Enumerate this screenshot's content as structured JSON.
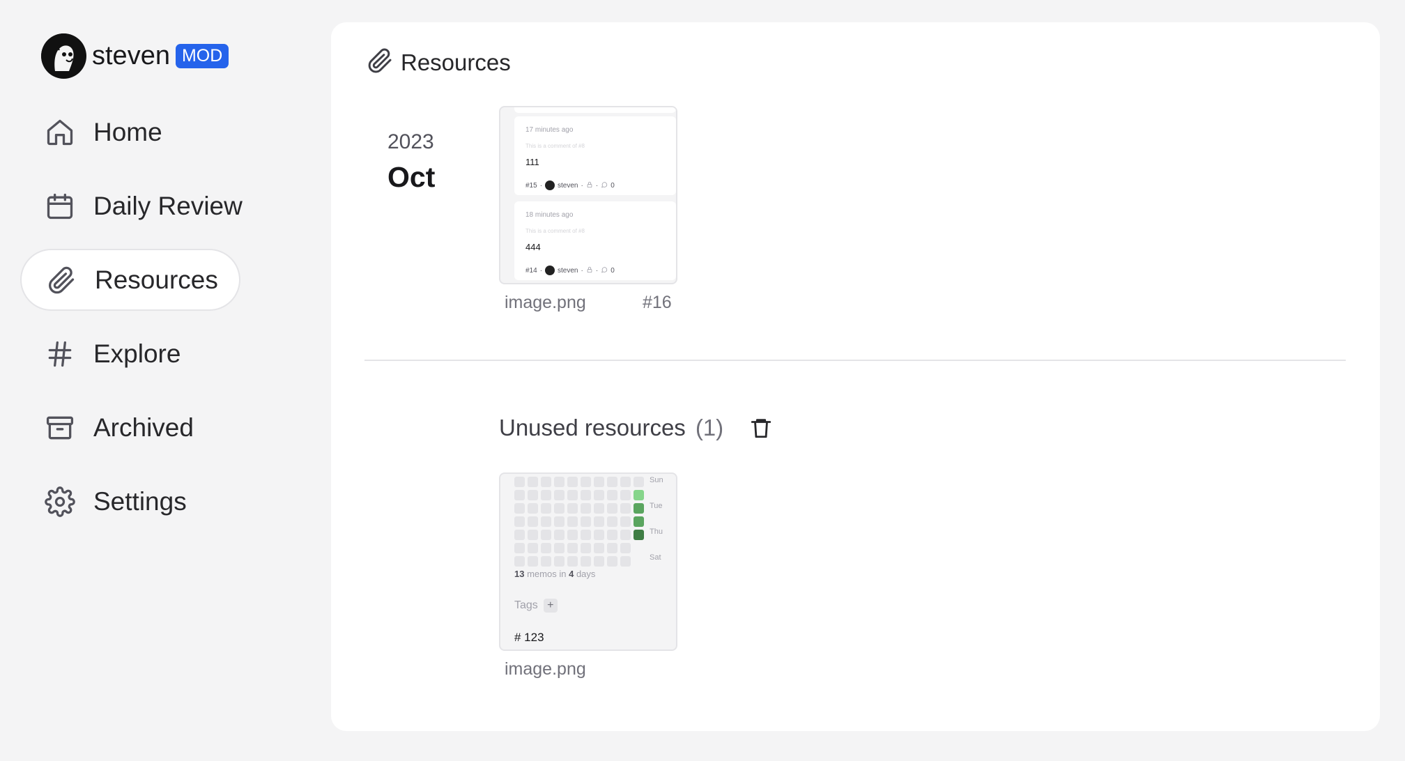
{
  "user": {
    "name": "steven",
    "badge": "MOD"
  },
  "nav": [
    {
      "id": "home",
      "label": "Home",
      "icon": "home-icon"
    },
    {
      "id": "daily-review",
      "label": "Daily Review",
      "icon": "calendar-icon"
    },
    {
      "id": "resources",
      "label": "Resources",
      "icon": "paperclip-icon",
      "active": true
    },
    {
      "id": "explore",
      "label": "Explore",
      "icon": "hash-icon"
    },
    {
      "id": "archived",
      "label": "Archived",
      "icon": "archive-icon"
    },
    {
      "id": "settings",
      "label": "Settings",
      "icon": "gear-icon"
    }
  ],
  "main": {
    "title": "Resources",
    "group": {
      "year": "2023",
      "month": "Oct"
    },
    "resources": [
      {
        "filename": "image.png",
        "memo_ref": "#16",
        "preview": {
          "cards": [
            {
              "time": "17 minutes ago",
              "note": "This is a comment of #8",
              "content": "111",
              "id": "#15",
              "author": "steven",
              "comments": "0"
            },
            {
              "time": "18 minutes ago",
              "note": "This is a comment of #8",
              "content": "444",
              "id": "#14",
              "author": "steven",
              "comments": "0"
            }
          ]
        }
      }
    ],
    "unused": {
      "title": "Unused resources",
      "count": "(1)",
      "items": [
        {
          "filename": "image.png",
          "preview": {
            "days": [
              "Sun",
              "Tue",
              "Thu",
              "Sat"
            ],
            "stat_count": "13",
            "stat_mid": "memos in",
            "stat_days": "4",
            "stat_end": "days",
            "tags_label": "Tags",
            "plus": "+",
            "tag": "# 123"
          }
        }
      ]
    }
  },
  "colors": {
    "accent": "#2563eb",
    "heat_light": "#86d58b",
    "heat_mid": "#5aa55f",
    "heat_dark": "#3f7d44"
  }
}
